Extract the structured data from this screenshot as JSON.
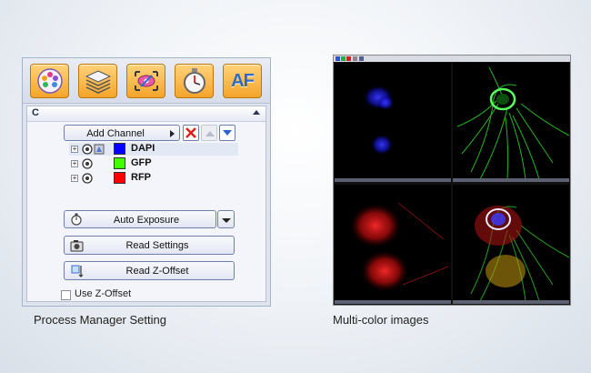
{
  "toolbar": {
    "icons": [
      "color-palette-icon",
      "layers-icon",
      "focus-target-icon",
      "stopwatch-icon"
    ],
    "af_label": "AF"
  },
  "section": {
    "title": "C"
  },
  "add_channel": {
    "label": "Add Channel"
  },
  "channels": [
    {
      "name": "DAPI",
      "color": "#0000ff"
    },
    {
      "name": "GFP",
      "color": "#44ff00"
    },
    {
      "name": "RFP",
      "color": "#ff0000"
    }
  ],
  "auto_exposure": {
    "label": "Auto Exposure"
  },
  "read_settings": {
    "label": "Read Settings"
  },
  "read_z_offset": {
    "label": "Read Z-Offset"
  },
  "use_z_offset": {
    "label": "Use Z-Offset",
    "checked": false
  },
  "captions": {
    "left": "Process Manager Setting",
    "right": "Multi-color images"
  }
}
